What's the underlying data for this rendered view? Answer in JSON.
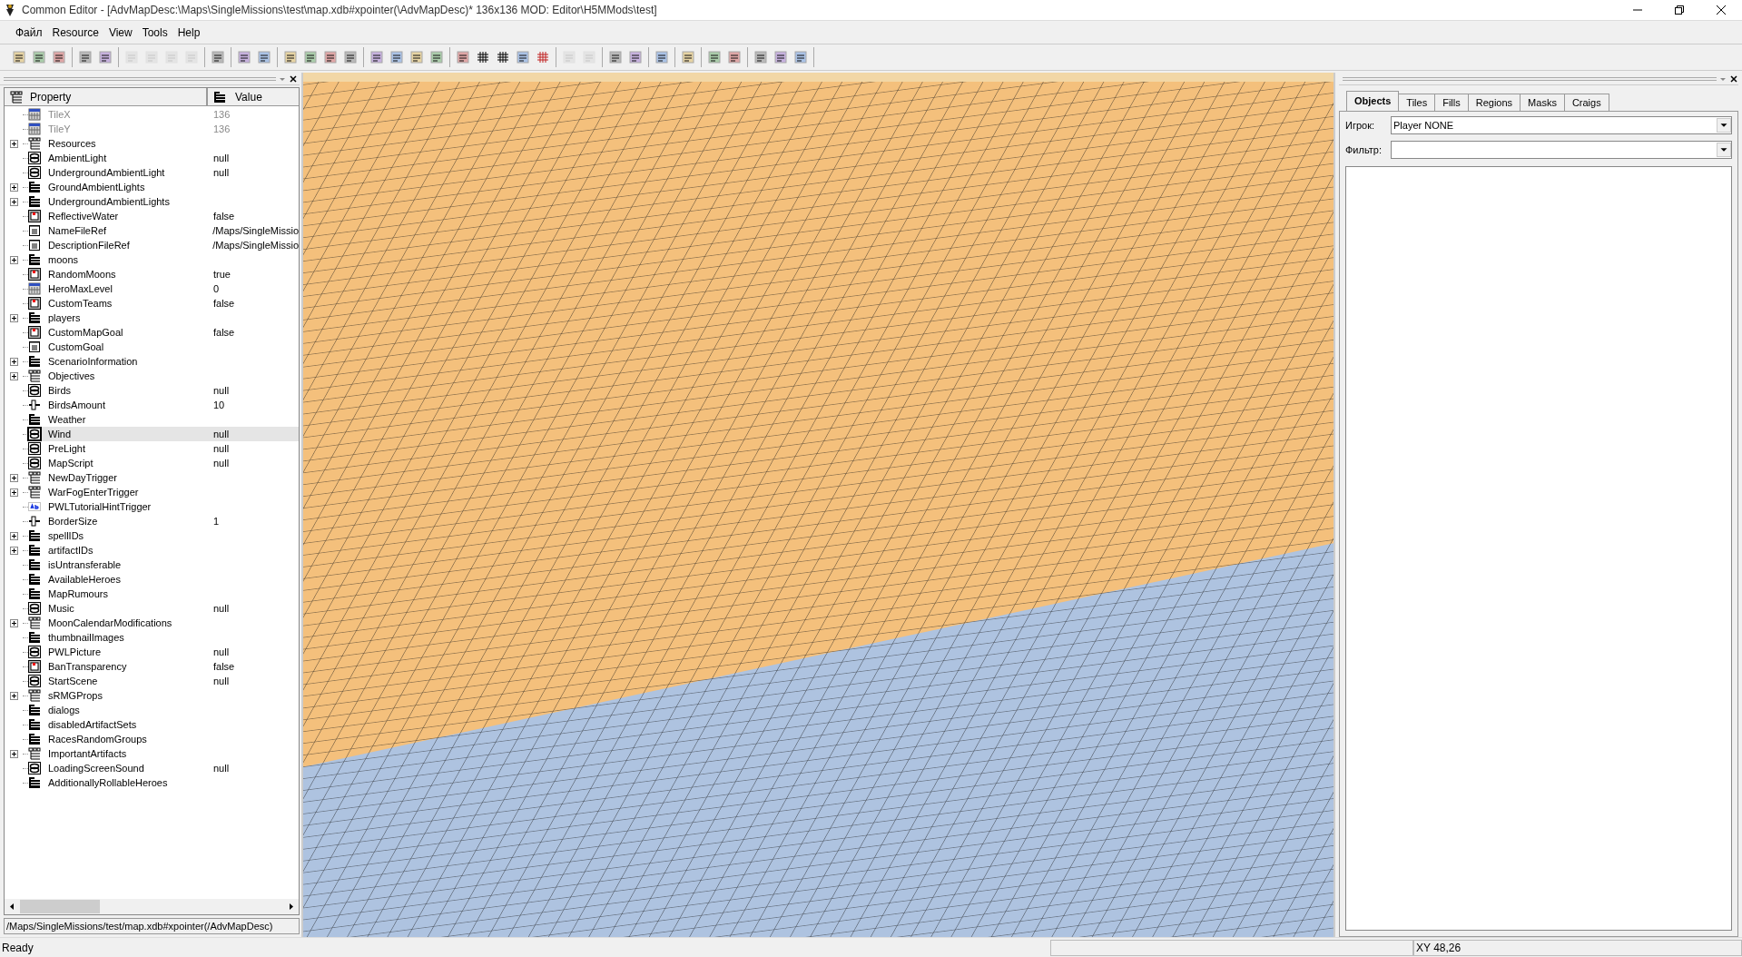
{
  "window": {
    "title": "Common Editor - [AdvMapDesc:\\Maps\\SingleMissions\\test\\map.xdb#xpointer(\\AdvMapDesc)* 136x136 MOD: Editor\\H5MMods\\test]"
  },
  "menu": [
    {
      "label": "Файл"
    },
    {
      "label": "Resource"
    },
    {
      "label": "View"
    },
    {
      "label": "Tools"
    },
    {
      "label": "Help"
    }
  ],
  "property_panel": {
    "columns": [
      "Property",
      "Value"
    ],
    "rows": [
      {
        "name": "TileX",
        "value": "136",
        "kind": "int",
        "expandable": false,
        "disabled": true,
        "selected": false
      },
      {
        "name": "TileY",
        "value": "136",
        "kind": "int",
        "expandable": false,
        "disabled": true,
        "selected": false
      },
      {
        "name": "Resources",
        "kind": "struct",
        "expandable": true,
        "disabled": false,
        "selected": false
      },
      {
        "name": "AmbientLight",
        "value": "null",
        "kind": "ref",
        "expandable": false,
        "disabled": false,
        "selected": false
      },
      {
        "name": "UndergroundAmbientLight",
        "value": "null",
        "kind": "ref",
        "expandable": false,
        "disabled": false,
        "selected": false
      },
      {
        "name": "GroundAmbientLights",
        "kind": "array",
        "expandable": true,
        "disabled": false,
        "selected": false
      },
      {
        "name": "UndergroundAmbientLights",
        "kind": "array",
        "expandable": true,
        "disabled": false,
        "selected": false
      },
      {
        "name": "ReflectiveWater",
        "value": "false",
        "kind": "bool",
        "expandable": false,
        "disabled": false,
        "selected": false
      },
      {
        "name": "NameFileRef",
        "value": "/Maps/SingleMissio",
        "kind": "file",
        "expandable": false,
        "disabled": false,
        "selected": false
      },
      {
        "name": "DescriptionFileRef",
        "value": "/Maps/SingleMissio",
        "kind": "file",
        "expandable": false,
        "disabled": false,
        "selected": false
      },
      {
        "name": "moons",
        "kind": "array",
        "expandable": true,
        "disabled": false,
        "selected": false
      },
      {
        "name": "RandomMoons",
        "value": "true",
        "kind": "bool",
        "expandable": false,
        "disabled": false,
        "selected": false
      },
      {
        "name": "HeroMaxLevel",
        "value": "0",
        "kind": "int",
        "expandable": false,
        "disabled": false,
        "selected": false
      },
      {
        "name": "CustomTeams",
        "value": "false",
        "kind": "bool",
        "expandable": false,
        "disabled": false,
        "selected": false
      },
      {
        "name": "players",
        "kind": "array",
        "expandable": true,
        "disabled": false,
        "selected": false
      },
      {
        "name": "CustomMapGoal",
        "value": "false",
        "kind": "bool",
        "expandable": false,
        "disabled": false,
        "selected": false
      },
      {
        "name": "CustomGoal",
        "kind": "file",
        "expandable": false,
        "disabled": false,
        "selected": false
      },
      {
        "name": "ScenarioInformation",
        "kind": "array",
        "expandable": true,
        "disabled": false,
        "selected": false
      },
      {
        "name": "Objectives",
        "kind": "struct",
        "expandable": true,
        "disabled": false,
        "selected": false
      },
      {
        "name": "Birds",
        "value": "null",
        "kind": "ref",
        "expandable": false,
        "disabled": false,
        "selected": false
      },
      {
        "name": "BirdsAmount",
        "value": "10",
        "kind": "slider",
        "expandable": false,
        "disabled": false,
        "selected": false
      },
      {
        "name": "Weather",
        "kind": "array",
        "expandable": false,
        "disabled": false,
        "selected": false
      },
      {
        "name": "Wind",
        "value": "null",
        "kind": "ref",
        "expandable": false,
        "disabled": false,
        "selected": true
      },
      {
        "name": "PreLight",
        "value": "null",
        "kind": "ref",
        "expandable": false,
        "disabled": false,
        "selected": false
      },
      {
        "name": "MapScript",
        "value": "null",
        "kind": "ref",
        "expandable": false,
        "disabled": false,
        "selected": false
      },
      {
        "name": "NewDayTrigger",
        "kind": "struct",
        "expandable": true,
        "disabled": false,
        "selected": false
      },
      {
        "name": "WarFogEnterTrigger",
        "kind": "struct",
        "expandable": true,
        "disabled": false,
        "selected": false
      },
      {
        "name": "PWLTutorialHintTrigger",
        "kind": "string",
        "expandable": false,
        "disabled": false,
        "selected": false
      },
      {
        "name": "BorderSize",
        "value": "1",
        "kind": "slider",
        "expandable": false,
        "disabled": false,
        "selected": false
      },
      {
        "name": "spellIDs",
        "kind": "array",
        "expandable": true,
        "disabled": false,
        "selected": false
      },
      {
        "name": "artifactIDs",
        "kind": "array",
        "expandable": true,
        "disabled": false,
        "selected": false
      },
      {
        "name": "isUntransferable",
        "kind": "array",
        "expandable": false,
        "disabled": false,
        "selected": false
      },
      {
        "name": "AvailableHeroes",
        "kind": "array",
        "expandable": false,
        "disabled": false,
        "selected": false
      },
      {
        "name": "MapRumours",
        "kind": "array",
        "expandable": false,
        "disabled": false,
        "selected": false
      },
      {
        "name": "Music",
        "value": "null",
        "kind": "ref",
        "expandable": false,
        "disabled": false,
        "selected": false
      },
      {
        "name": "MoonCalendarModifications",
        "kind": "struct",
        "expandable": true,
        "disabled": false,
        "selected": false
      },
      {
        "name": "thumbnailImages",
        "kind": "array",
        "expandable": false,
        "disabled": false,
        "selected": false
      },
      {
        "name": "PWLPicture",
        "value": "null",
        "kind": "ref",
        "expandable": false,
        "disabled": false,
        "selected": false
      },
      {
        "name": "BanTransparency",
        "value": "false",
        "kind": "bool",
        "expandable": false,
        "disabled": false,
        "selected": false
      },
      {
        "name": "StartScene",
        "value": "null",
        "kind": "ref",
        "expandable": false,
        "disabled": false,
        "selected": false
      },
      {
        "name": "sRMGProps",
        "kind": "struct",
        "expandable": true,
        "disabled": false,
        "selected": false
      },
      {
        "name": "dialogs",
        "kind": "array",
        "expandable": false,
        "disabled": false,
        "selected": false
      },
      {
        "name": "disabledArtifactSets",
        "kind": "array",
        "expandable": false,
        "disabled": false,
        "selected": false
      },
      {
        "name": "RacesRandomGroups",
        "kind": "array",
        "expandable": false,
        "disabled": false,
        "selected": false
      },
      {
        "name": "ImportantArtifacts",
        "kind": "struct",
        "expandable": true,
        "disabled": false,
        "selected": false
      },
      {
        "name": "LoadingScreenSound",
        "value": "null",
        "kind": "ref",
        "expandable": false,
        "disabled": false,
        "selected": false
      },
      {
        "name": "AdditionallyRollableHeroes",
        "kind": "array",
        "expandable": false,
        "disabled": false,
        "selected": false
      }
    ],
    "path": "/Maps/SingleMissions/test/map.xdb#xpointer(/AdvMapDesc)"
  },
  "tool_panel": {
    "tabs": [
      {
        "label": "Objects",
        "selected": true
      },
      {
        "label": "Tiles",
        "selected": false
      },
      {
        "label": "Fills",
        "selected": false
      },
      {
        "label": "Regions",
        "selected": false
      },
      {
        "label": "Masks",
        "selected": false
      },
      {
        "label": "Craigs",
        "selected": false
      }
    ],
    "fields": [
      {
        "label": "Игрок:",
        "value": "Player NONE"
      },
      {
        "label": "Фильтр:"
      }
    ]
  },
  "status_bar": {
    "message": "Ready",
    "coordinates": "XY 48,26"
  }
}
